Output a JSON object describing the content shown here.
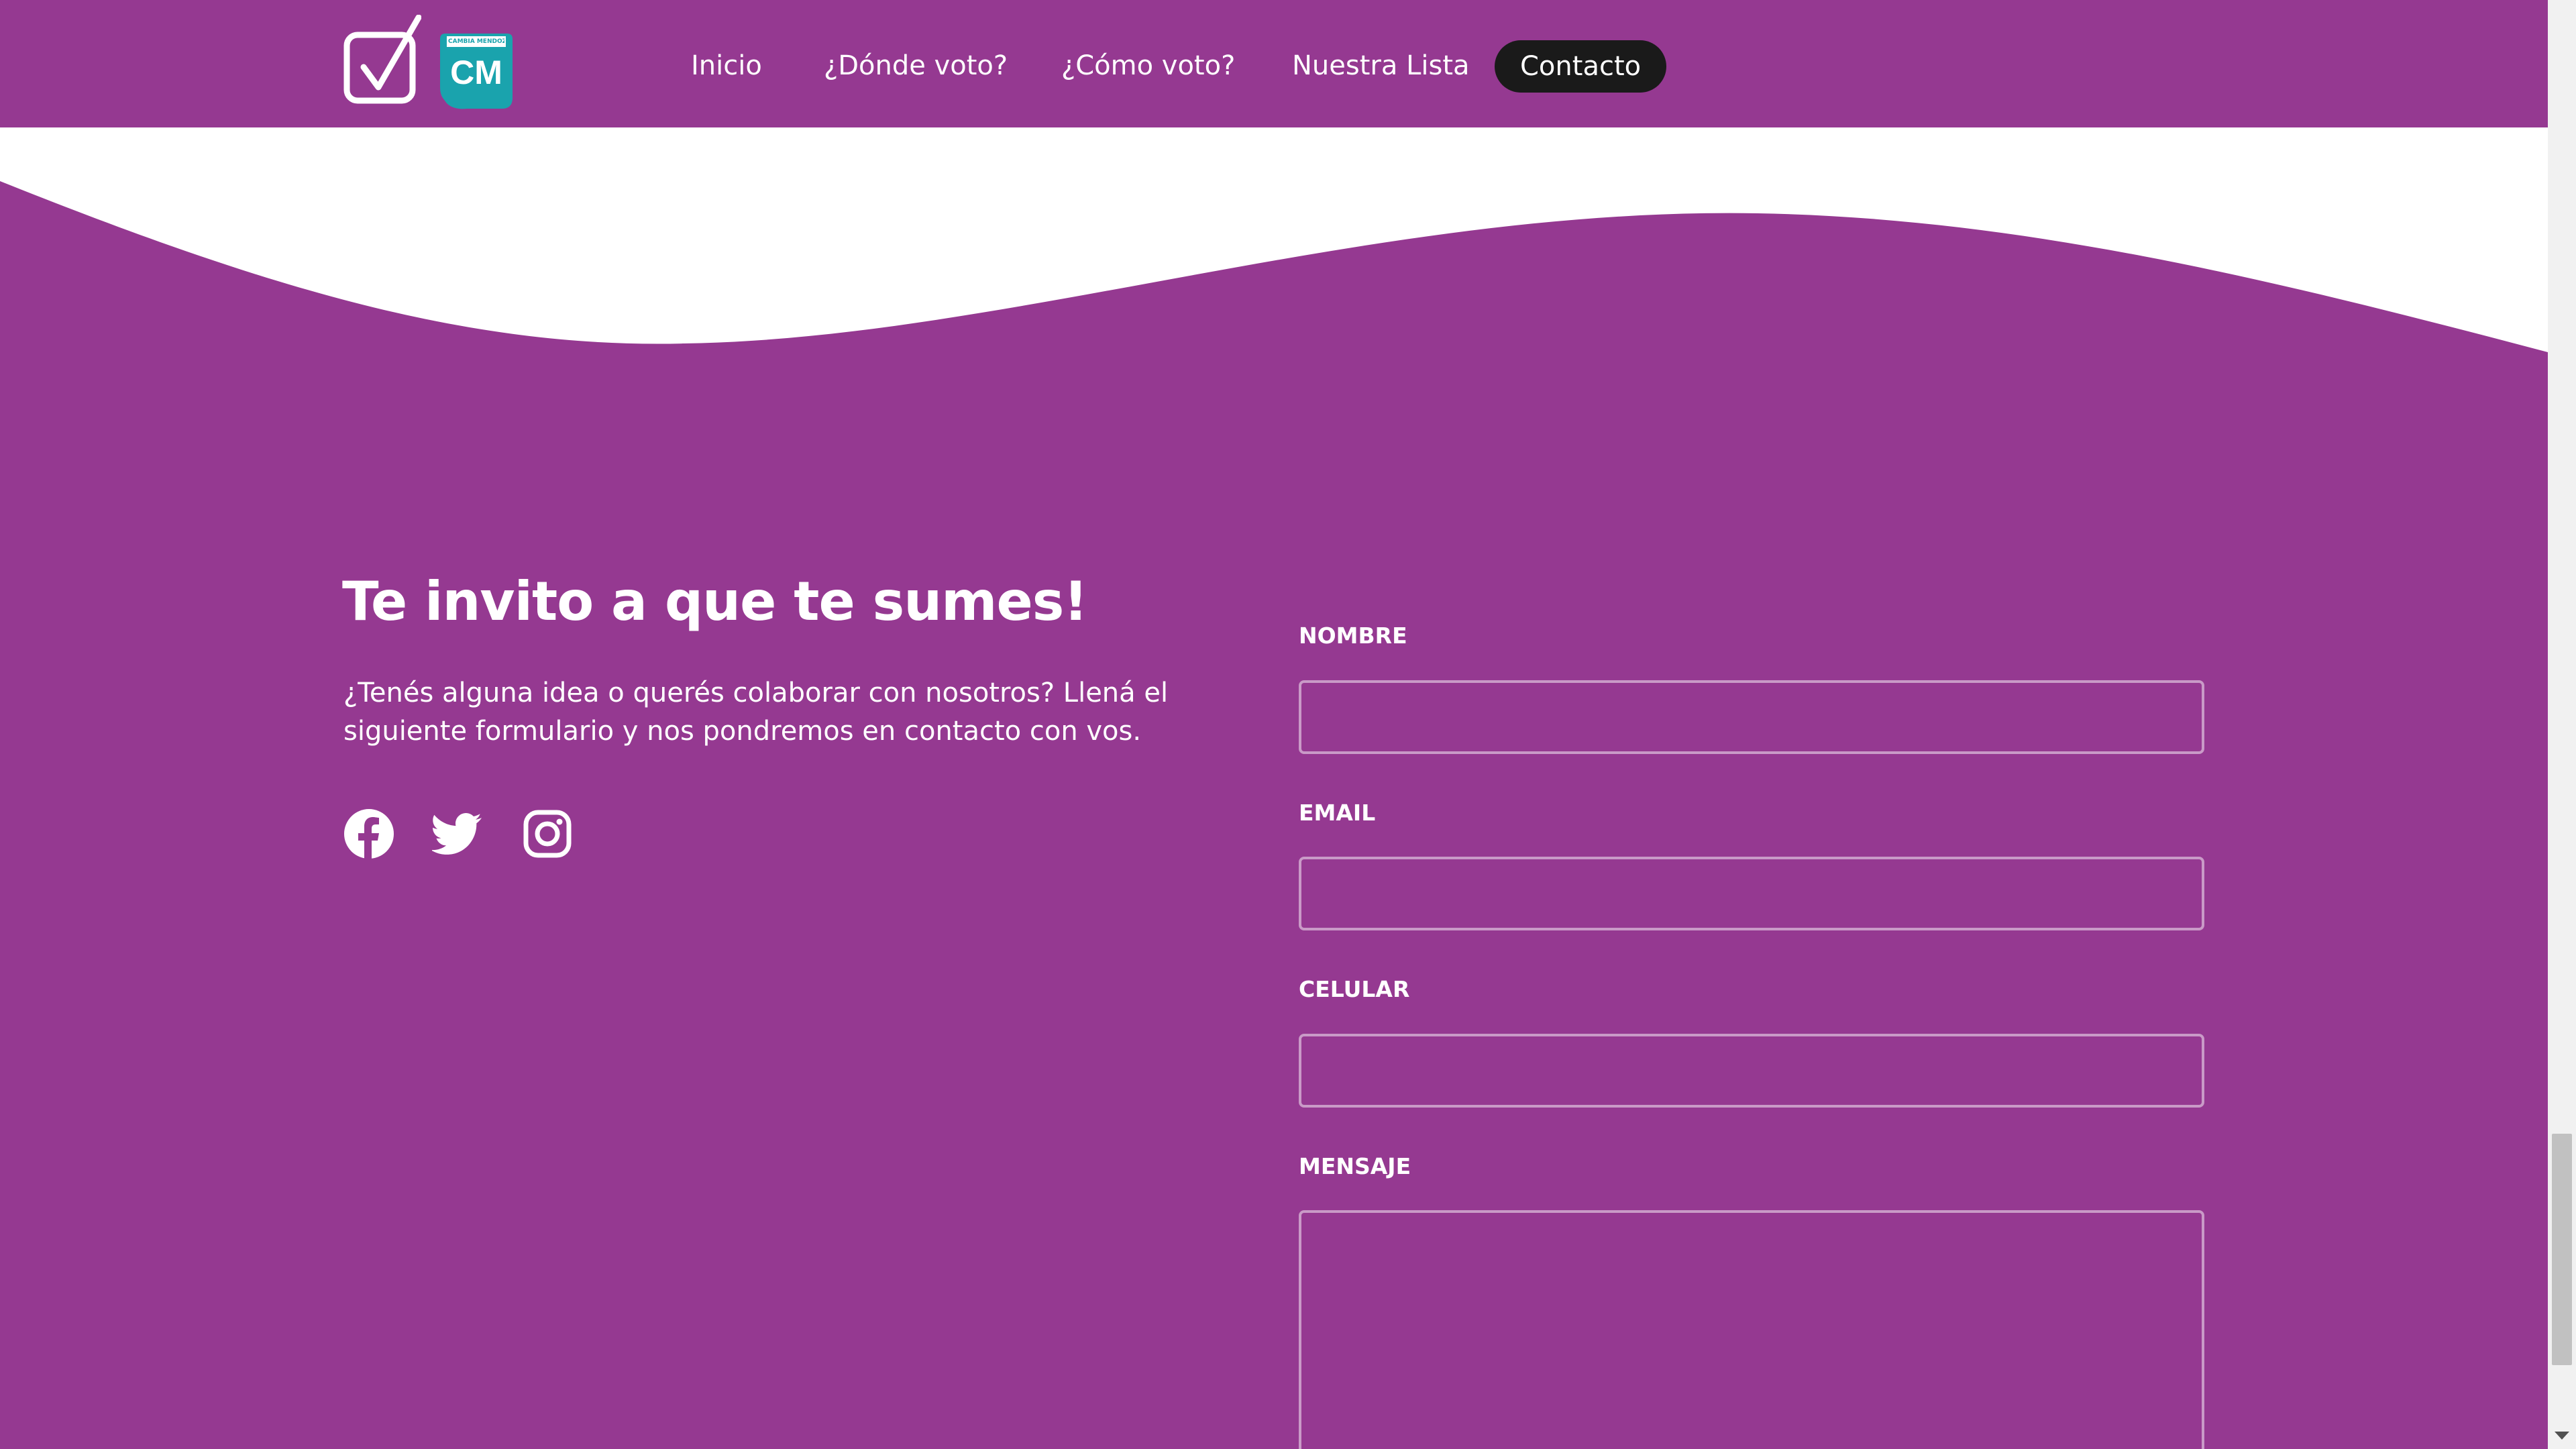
{
  "colors": {
    "brand_purple": "#953991",
    "nav_active_bg": "#1a1a1a",
    "logo_teal": "#1aa3ad",
    "input_border": "#c99ac7",
    "text": "#ffffff"
  },
  "header": {
    "logo_check_icon": "checkbox-vote-icon",
    "logo_cm": {
      "small_text": "CAMBIA MENDOZA",
      "big_text": "CM"
    },
    "nav": [
      {
        "label": "Inicio",
        "active": false
      },
      {
        "label": "¿Dónde voto?",
        "active": false
      },
      {
        "label": "¿Cómo voto?",
        "active": false
      },
      {
        "label": "Nuestra Lista",
        "active": false
      },
      {
        "label": "Contacto",
        "active": true
      }
    ]
  },
  "contact": {
    "title": "Te invito a que te sumes!",
    "description": "¿Tenés alguna idea o querés colaborar con nosotros? Llená el siguiente formulario y nos pondremos en contacto con vos.",
    "social": [
      {
        "name": "facebook",
        "icon": "facebook-icon"
      },
      {
        "name": "twitter",
        "icon": "twitter-icon"
      },
      {
        "name": "instagram",
        "icon": "instagram-icon"
      }
    ]
  },
  "form": {
    "nombre": {
      "label": "NOMBRE",
      "value": "",
      "placeholder": ""
    },
    "email": {
      "label": "EMAIL",
      "value": "",
      "placeholder": ""
    },
    "celular": {
      "label": "CELULAR",
      "value": "",
      "placeholder": ""
    },
    "mensaje": {
      "label": "MENSAJE",
      "value": "",
      "placeholder": ""
    }
  }
}
